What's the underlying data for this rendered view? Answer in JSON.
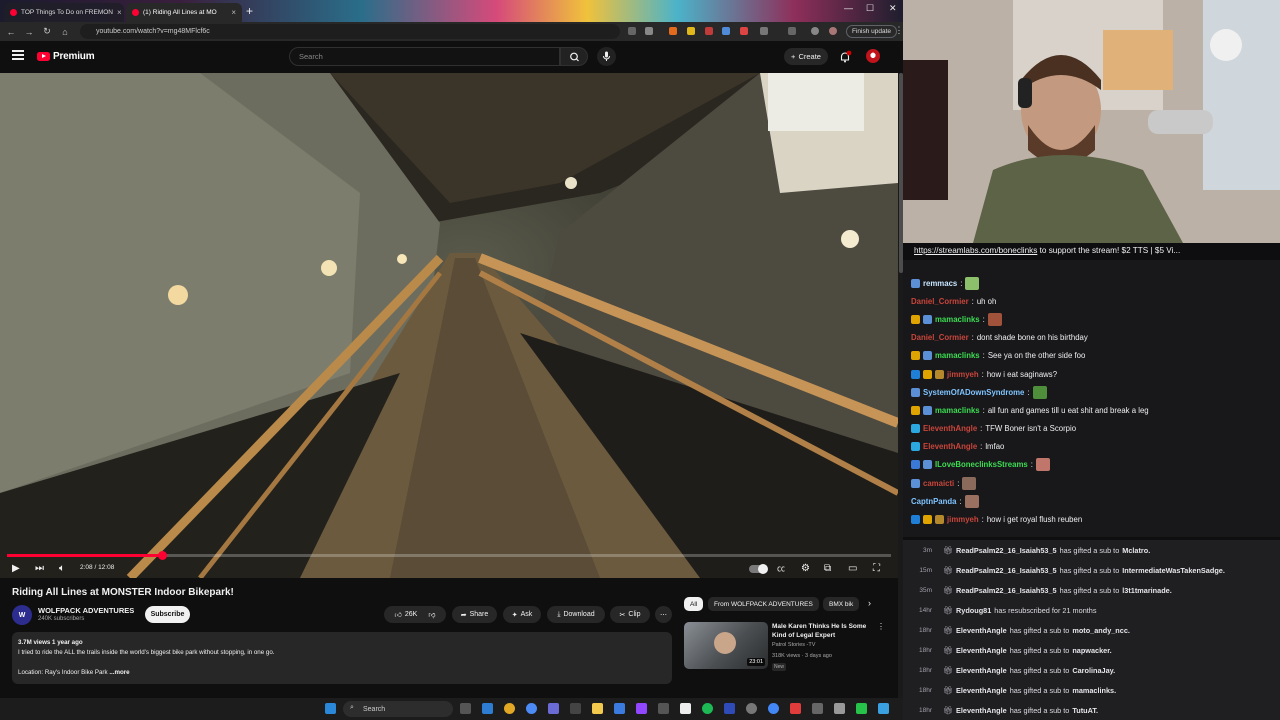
{
  "browser": {
    "tabs": [
      {
        "title": "TOP Things To Do on FREMON",
        "active": false
      },
      {
        "title": "(1) Riding All Lines at MO",
        "active": true
      }
    ],
    "url": "youtube.com/watch?v=mg48MFlcf6c",
    "finish_update": "Finish update"
  },
  "youtube": {
    "logo_text": "Premium",
    "search_placeholder": "Search",
    "create_label": "Create",
    "video": {
      "time": "2:08 / 12:08",
      "progress": 0.176
    },
    "title": "Riding All Lines at MONSTER Indoor Bikepark!",
    "channel": {
      "name": "WOLFPACK ADVENTURES",
      "subs": "240K subscribers",
      "avatar_text": "W"
    },
    "subscribe_label": "Subscribe",
    "actions": {
      "likes": "26K",
      "share": "Share",
      "ask": "Ask",
      "download": "Download",
      "clip": "Clip"
    },
    "description": {
      "meta": "3.7M views  1 year ago",
      "line1": "I tried to ride the ALL the trails inside the world's biggest bike park without stopping, in one go.",
      "line2": "Location: Ray's Indoor Bike Park",
      "more": "...more"
    },
    "chips": [
      "All",
      "From WOLFPACK ADVENTURES",
      "BMX bik"
    ],
    "recommendation": {
      "title": "Male Karen Thinks He Is Some Kind of Legal Expert",
      "channel": "Patrol Stories -TV",
      "meta": "318K views · 3 days ago",
      "badge": "New",
      "duration": "23:01"
    }
  },
  "stream": {
    "banner_link": "https://streamlabs.com/boneclinks",
    "banner_rest": " to support the stream! $2 TTS | $5 Vi...",
    "chat": [
      {
        "user": "remmacs",
        "color": "#c9e6ff",
        "text": "",
        "emote": "#8dc06b",
        "badges": [
          "#5b8fd6"
        ]
      },
      {
        "user": "Daniel_Cormier",
        "color": "#c9453a",
        "text": "uh oh",
        "emote": "",
        "badges": []
      },
      {
        "user": "mamaclinks",
        "color": "#3ddc52",
        "text": "",
        "emote": "#a0523b",
        "badges": [
          "#e0a400",
          "#5b8fd6"
        ]
      },
      {
        "user": "Daniel_Cormier",
        "color": "#c9453a",
        "text": "dont shade bone on his birthday",
        "emote": "",
        "badges": []
      },
      {
        "user": "mamaclinks",
        "color": "#3ddc52",
        "text": "See ya on the other side foo",
        "emote": "",
        "badges": [
          "#e0a400",
          "#5b8fd6"
        ]
      },
      {
        "user": "jimmyeh",
        "color": "#c9453a",
        "text": "how i eat saginaws?",
        "emote": "",
        "badges": [
          "#1f7fd6",
          "#e0a400",
          "#b5882c"
        ]
      },
      {
        "user": "SystemOfADownSyndrome",
        "color": "#7fc4ff",
        "text": "",
        "emote": "#4f8f3c",
        "badges": [
          "#5b8fd6"
        ]
      },
      {
        "user": "mamaclinks",
        "color": "#3ddc52",
        "text": "all fun and games till u eat shit and break a leg",
        "emote": "",
        "badges": [
          "#e0a400",
          "#5b8fd6"
        ]
      },
      {
        "user": "EleventhAngle",
        "color": "#c9453a",
        "text": "TFW Boner isn't a Scorpio",
        "emote": "",
        "badges": [
          "#2ba8e0"
        ]
      },
      {
        "user": "EleventhAngle",
        "color": "#c9453a",
        "text": "lmfao",
        "emote": "",
        "badges": [
          "#2ba8e0"
        ]
      },
      {
        "user": "ILoveBoneclinksStreams",
        "color": "#3ddc52",
        "text": "",
        "emote": "#c0766a",
        "badges": [
          "#3a7ad6",
          "#5b8fd6"
        ]
      },
      {
        "user": "camaicti",
        "color": "#c9453a",
        "text": "",
        "emote": "#8a6a5a",
        "badges": [
          "#5b8fd6"
        ]
      },
      {
        "user": "CaptnPanda",
        "color": "#7fc4ff",
        "text": "",
        "emote": "#9a7060",
        "badges": []
      },
      {
        "user": "jimmyeh",
        "color": "#c9453a",
        "text": "how i get royal flush reuben",
        "emote": "",
        "badges": [
          "#1f7fd6",
          "#e0a400",
          "#b5882c"
        ]
      }
    ],
    "events": [
      {
        "time": "3m",
        "user": "ReadPsalm22_16_Isaiah53_5",
        "action": "has gifted a sub to",
        "target": "Mclatro."
      },
      {
        "time": "15m",
        "user": "ReadPsalm22_16_Isaiah53_5",
        "action": "has gifted a sub to",
        "target": "IntermediateWasTakenSadge."
      },
      {
        "time": "35m",
        "user": "ReadPsalm22_16_Isaiah53_5",
        "action": "has gifted a sub to",
        "target": "l3t1tmarinade."
      },
      {
        "time": "14hr",
        "user": "Rydoug81",
        "action": "has resubscribed for 21 months",
        "target": ""
      },
      {
        "time": "18hr",
        "user": "EleventhAngle",
        "action": "has gifted a sub to",
        "target": "moto_andy_ncc."
      },
      {
        "time": "18hr",
        "user": "EleventhAngle",
        "action": "has gifted a sub to",
        "target": "napwacker."
      },
      {
        "time": "18hr",
        "user": "EleventhAngle",
        "action": "has gifted a sub to",
        "target": "CarolinaJay."
      },
      {
        "time": "18hr",
        "user": "EleventhAngle",
        "action": "has gifted a sub to",
        "target": "mamaclinks."
      },
      {
        "time": "18hr",
        "user": "EleventhAngle",
        "action": "has gifted a sub to",
        "target": "TutuAT."
      }
    ]
  },
  "taskbar": {
    "search_label": "Search"
  }
}
